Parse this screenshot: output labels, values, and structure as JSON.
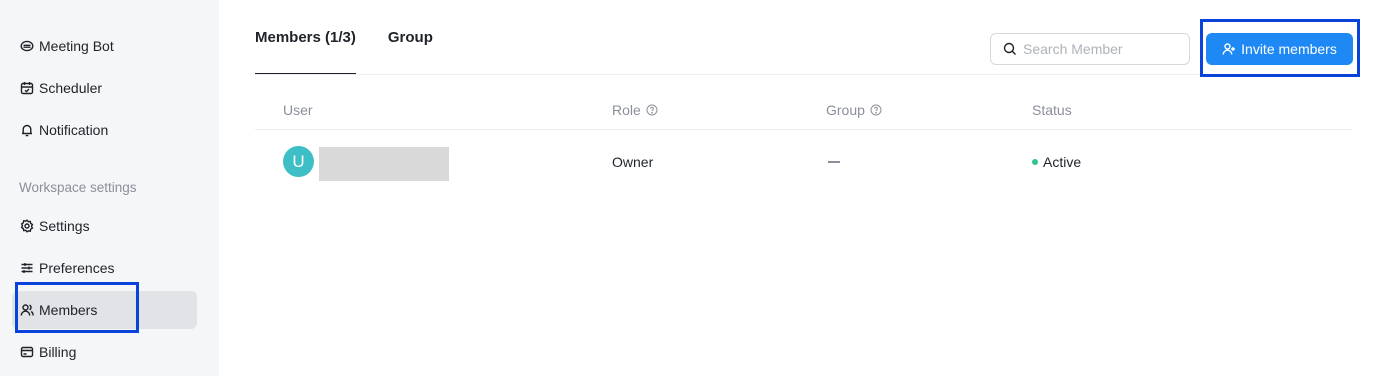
{
  "sidebar": {
    "items": [
      {
        "label": "Meeting Bot",
        "icon": "meeting-bot-icon"
      },
      {
        "label": "Scheduler",
        "icon": "calendar-icon"
      },
      {
        "label": "Notification",
        "icon": "bell-icon"
      },
      {
        "label": "Settings",
        "icon": "gear-icon"
      },
      {
        "label": "Preferences",
        "icon": "sliders-icon"
      },
      {
        "label": "Members",
        "icon": "users-icon",
        "active": true
      },
      {
        "label": "Billing",
        "icon": "credit-card-icon"
      }
    ],
    "section_label": "Workspace settings"
  },
  "tabs": [
    {
      "label": "Members (1/3)",
      "active": true
    },
    {
      "label": "Group",
      "active": false
    }
  ],
  "search": {
    "placeholder": "Search Member",
    "value": ""
  },
  "invite_button": {
    "label": "Invite members"
  },
  "table": {
    "columns": [
      "User",
      "Role",
      "Group",
      "Status"
    ],
    "rows": [
      {
        "avatar_initial": "U",
        "role": "Owner",
        "group": "—",
        "status": "Active"
      }
    ]
  },
  "colors": {
    "accent": "#1e88f5",
    "highlight": "#0a43dc",
    "avatar": "#3ebfc6",
    "status_active": "#2fc58a",
    "sidebar_bg": "#f5f6f7"
  }
}
